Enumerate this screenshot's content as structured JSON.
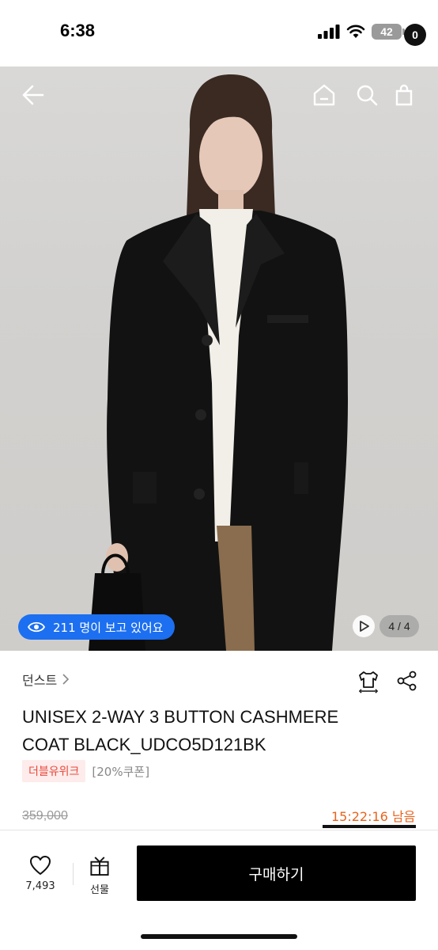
{
  "status_bar": {
    "time": "6:38",
    "battery": "42"
  },
  "header": {
    "cart_count": "0"
  },
  "gallery": {
    "viewers_text": "211 명이 보고 있어요",
    "page_indicator": "4 / 4"
  },
  "product": {
    "brand": "던스트",
    "title_line1": "UNISEX 2-WAY 3 BUTTON CASHMERE",
    "title_line2": "COAT BLACK_UDCO5D121BK",
    "badge": "더블유위크",
    "coupon": "[20%쿠폰]",
    "original_price": "359,000",
    "timer": "15:22:16 남음"
  },
  "bottom_bar": {
    "like_count": "7,493",
    "gift_label": "선물",
    "buy_label": "구매하기"
  },
  "colors": {
    "accent_blue": "#1c6ff0",
    "badge_red": "#e8473b",
    "timer_orange": "#e8631d"
  },
  "icons": [
    "back-arrow-icon",
    "home-icon",
    "search-icon",
    "shopping-bag-icon",
    "eye-icon",
    "play-icon",
    "chevron-right-icon",
    "size-guide-icon",
    "share-icon",
    "heart-icon",
    "gift-icon"
  ]
}
